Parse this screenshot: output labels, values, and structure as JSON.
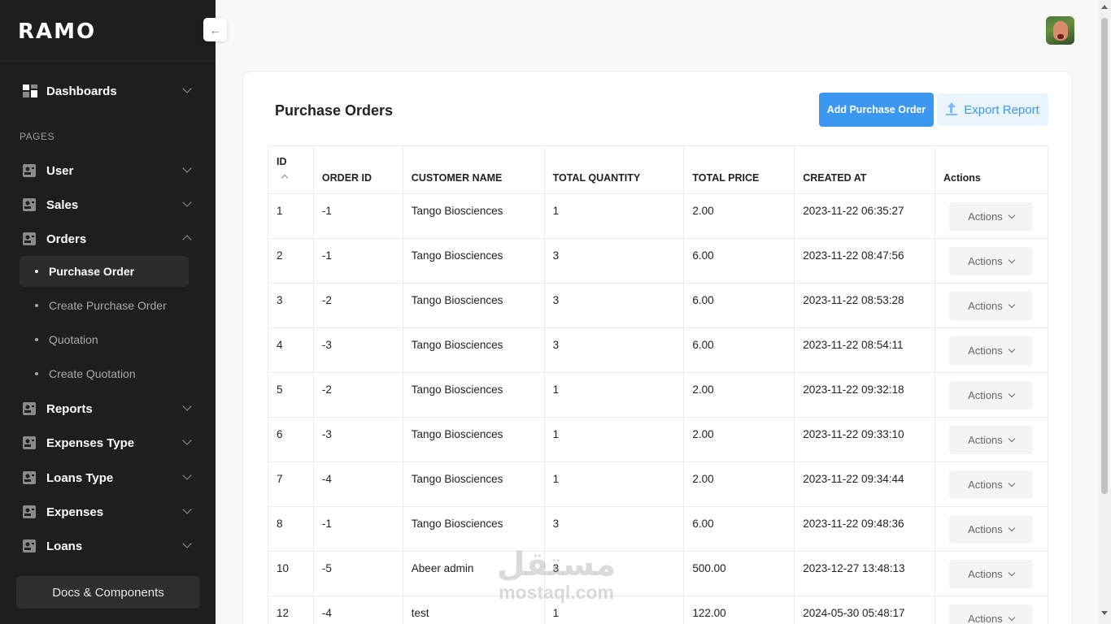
{
  "brand": {
    "logo": "RAMO"
  },
  "sidebar": {
    "collapse_icon": "arrow-left-icon",
    "dashboards": "Dashboards",
    "section_label": "PAGES",
    "items": [
      {
        "label": "User"
      },
      {
        "label": "Sales"
      },
      {
        "label": "Orders"
      },
      {
        "label": "Reports"
      },
      {
        "label": "Expenses Type"
      },
      {
        "label": "Loans Type"
      },
      {
        "label": "Expenses"
      },
      {
        "label": "Loans"
      }
    ],
    "orders_sub": [
      {
        "label": "Purchase Order",
        "active": true
      },
      {
        "label": "Create Purchase Order"
      },
      {
        "label": "Quotation"
      },
      {
        "label": "Create Quotation"
      }
    ],
    "docs_button": "Docs & Components"
  },
  "card": {
    "title": "Purchase Orders",
    "add_button": "Add Purchase Order",
    "export_button": "Export Report"
  },
  "table": {
    "headers": [
      "ID",
      "ORDER ID",
      "CUSTOMER NAME",
      "TOTAL QUANTITY",
      "TOTAL PRICE",
      "CREATED AT",
      "Actions"
    ],
    "action_label": "Actions",
    "rows": [
      [
        "1",
        "-1",
        "Tango Biosciences",
        "1",
        "2.00",
        "2023-11-22 06:35:27"
      ],
      [
        "2",
        "-1",
        "Tango Biosciences",
        "3",
        "6.00",
        "2023-11-22 08:47:56"
      ],
      [
        "3",
        "-2",
        "Tango Biosciences",
        "3",
        "6.00",
        "2023-11-22 08:53:28"
      ],
      [
        "4",
        "-3",
        "Tango Biosciences",
        "3",
        "6.00",
        "2023-11-22 08:54:11"
      ],
      [
        "5",
        "-2",
        "Tango Biosciences",
        "1",
        "2.00",
        "2023-11-22 09:32:18"
      ],
      [
        "6",
        "-3",
        "Tango Biosciences",
        "1",
        "2.00",
        "2023-11-22 09:33:10"
      ],
      [
        "7",
        "-4",
        "Tango Biosciences",
        "1",
        "2.00",
        "2023-11-22 09:34:44"
      ],
      [
        "8",
        "-1",
        "Tango Biosciences",
        "3",
        "6.00",
        "2023-11-22 09:48:36"
      ],
      [
        "10",
        "-5",
        "Abeer admin",
        "3",
        "500.00",
        "2023-12-27 13:48:13"
      ],
      [
        "12",
        "-4",
        "test",
        "1",
        "122.00",
        "2024-05-30 05:48:17"
      ]
    ]
  },
  "watermark": {
    "arabic": "مستقل",
    "latin": "mostaql.com"
  },
  "colors": {
    "sidebar_bg": "#1e1e1e",
    "primary": "#3b97f0",
    "export_bg": "#eaf4fd"
  }
}
